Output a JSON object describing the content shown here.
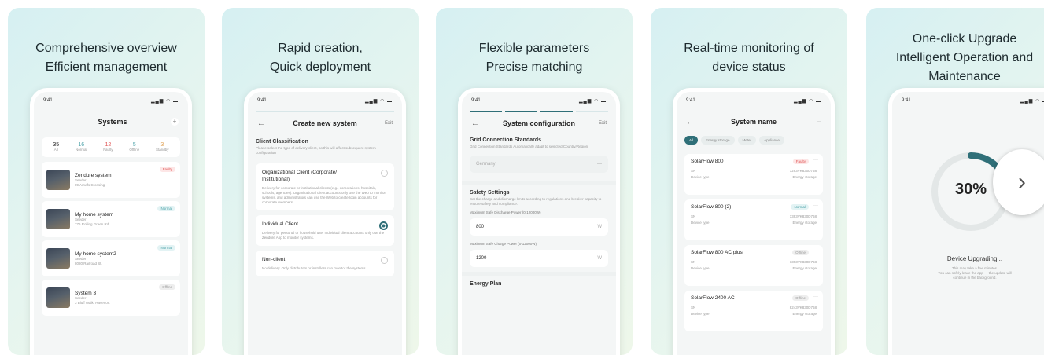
{
  "cards": [
    {
      "title": "Comprehensive overview\nEfficient management",
      "phone": {
        "time": "9:41",
        "screen_title": "Systems",
        "stats": [
          {
            "value": "35",
            "label": "All"
          },
          {
            "value": "16",
            "label": "Normal"
          },
          {
            "value": "12",
            "label": "Faulty"
          },
          {
            "value": "5",
            "label": "Offline"
          },
          {
            "value": "3",
            "label": "Standby"
          }
        ],
        "systems": [
          {
            "name": "Zendure system",
            "role": "Seeder",
            "address": "89 Arruffs Crossing",
            "status": "Faulty",
            "kind": "faulty"
          },
          {
            "name": "My home system",
            "role": "Seeder",
            "address": "776 Rolling Green Rd",
            "status": "Normal",
            "kind": "normal"
          },
          {
            "name": "My home system2",
            "role": "Seeder",
            "address": "8080 Railroad St.",
            "status": "Normal",
            "kind": "normal"
          },
          {
            "name": "System 3",
            "role": "Seeder",
            "address": "3 Bluff Walk, Haverlort",
            "status": "Offline",
            "kind": "offline"
          }
        ]
      }
    },
    {
      "title": "Rapid creation,\nQuick deployment",
      "phone": {
        "time": "9:41",
        "screen_title": "Create new system",
        "exit": "Exit",
        "section": "Client Classification",
        "section_desc": "Please select the type of delivery client, as this will affect subsequent system configuration",
        "options": [
          {
            "title": "Organizational Client (Corporate/ Institutional)",
            "desc": "Delivery for corporate or institutional clients (e.g., corporations, hospitals, schools, agencies). Organizational client accounts only use the Web to monitor systems, and administrators can use the Web to create login accounts for corporate members.",
            "selected": false
          },
          {
            "title": "Individual Client",
            "desc": "Delivery for personal or household use. Individual client accounts only use the Zendure App to monitor systems.",
            "selected": true
          },
          {
            "title": "Non-client",
            "desc": "No delivery. Only distributors or installers can monitor the systems.",
            "selected": false
          }
        ]
      }
    },
    {
      "title": "Flexible parameters\nPrecise matching",
      "phone": {
        "time": "9:41",
        "screen_title": "System configuration",
        "exit": "Exit",
        "grid_title": "Grid Connection Standards",
        "grid_desc": "Grid Connection Standards Automatically adapt to selected Country/Region",
        "country": "Germany",
        "safety_title": "Safety Settings",
        "safety_desc": "Set the charge and discharge limits according to regulations and breaker capacity to ensure safety and compliance.",
        "discharge_label": "Maximum Safe Discharge Power (0-12000W)",
        "discharge_value": "800",
        "charge_label": "Maximum Safe Charge Power (0-12000W)",
        "charge_value": "1200",
        "unit": "W",
        "energy_title": "Energy Plan"
      }
    },
    {
      "title": "Real-time monitoring of\ndevice status",
      "phone": {
        "time": "9:41",
        "screen_title": "System name",
        "more": "···",
        "filters": [
          "All",
          "Energy storage",
          "Meter",
          "Appliance"
        ],
        "devices": [
          {
            "name": "SolarFlow 800",
            "status": "Faulty",
            "kind": "faulty",
            "sn": "1293VK830D768",
            "type": "Energy storage"
          },
          {
            "name": "SolarFlow 800 (2)",
            "status": "Normal",
            "kind": "normal",
            "sn": "1393VK830D768",
            "type": "Energy storage"
          },
          {
            "name": "SolarFlow 800 AC plus",
            "status": "Offline",
            "kind": "offline",
            "sn": "1393VK830D768",
            "type": "Energy storage"
          },
          {
            "name": "SolarFlow 2400 AC",
            "status": "Offline",
            "kind": "offline",
            "sn": "8243VK830D768",
            "type": "Energy storage"
          }
        ],
        "sn_label": "SN",
        "type_label": "Device type"
      }
    },
    {
      "title": "One-click Upgrade\nIntelligent Operation and\nMaintenance",
      "phone": {
        "time": "9:41",
        "progress_text": "30%",
        "progress_value": 0.3,
        "upgrade_title": "Device Upgrading...",
        "upgrade_desc": "This may take a few minutes.\nYou can safely leave the app — the update will\ncontinue in the background."
      }
    }
  ],
  "next_icon": "chevron-right-icon"
}
